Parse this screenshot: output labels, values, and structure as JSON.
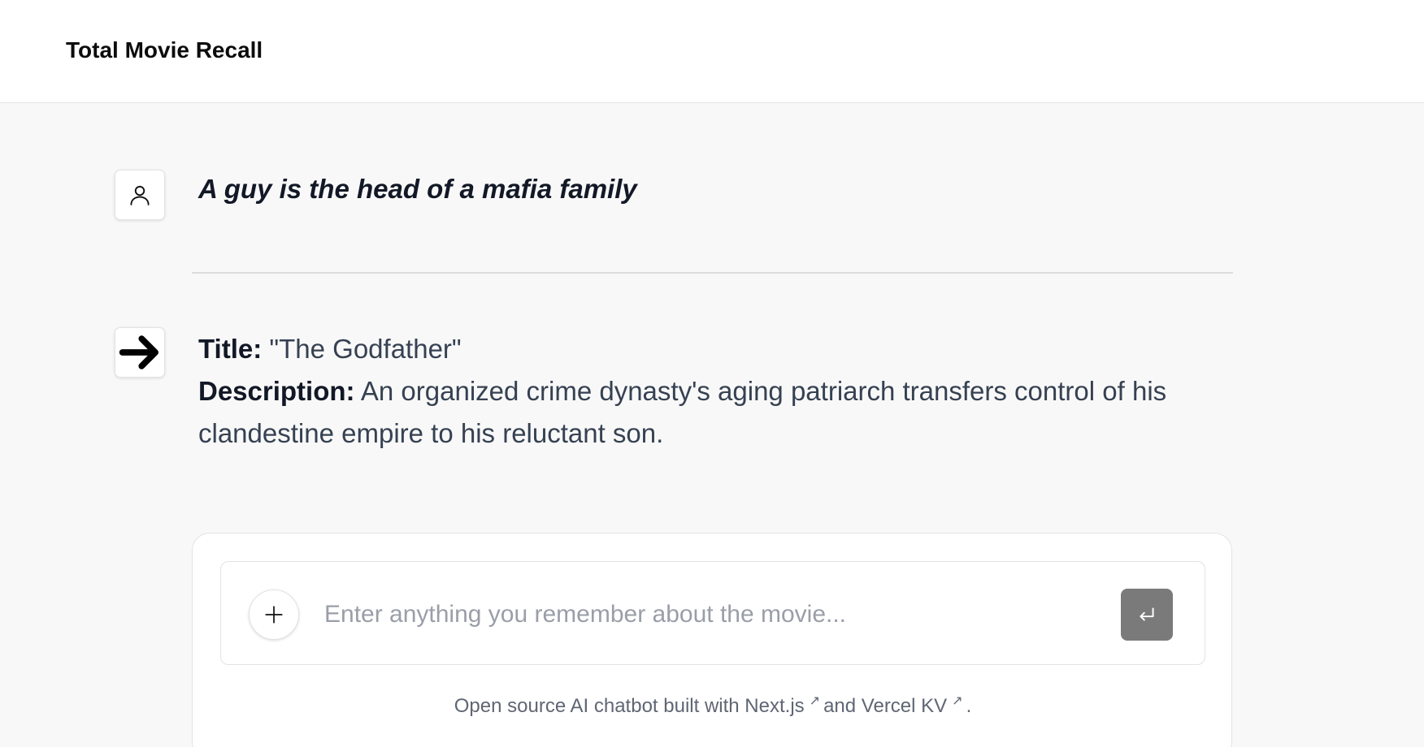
{
  "header": {
    "title": "Total Movie Recall"
  },
  "conversation": {
    "user_message": "A guy is the head of a mafia family",
    "bot_response": {
      "title_label": "Title:",
      "title_value": " \"The Godfather\"",
      "description_label": "Description:",
      "description_value": " An organized crime dynasty's aging patriarch transfers control of his clandestine empire to his reluctant son."
    }
  },
  "composer": {
    "placeholder": "Enter anything you remember about the movie...",
    "value": ""
  },
  "footer": {
    "prefix": "Open source AI chatbot built with ",
    "link1": "Next.js",
    "middle": "and ",
    "link2": "Vercel KV",
    "suffix": "."
  },
  "icons": {
    "user_avatar": "user-icon",
    "bot_avatar": "arrow-right-icon",
    "new_chat": "plus-icon",
    "send": "enter-icon",
    "external_link": "arrow-up-right-icon"
  }
}
